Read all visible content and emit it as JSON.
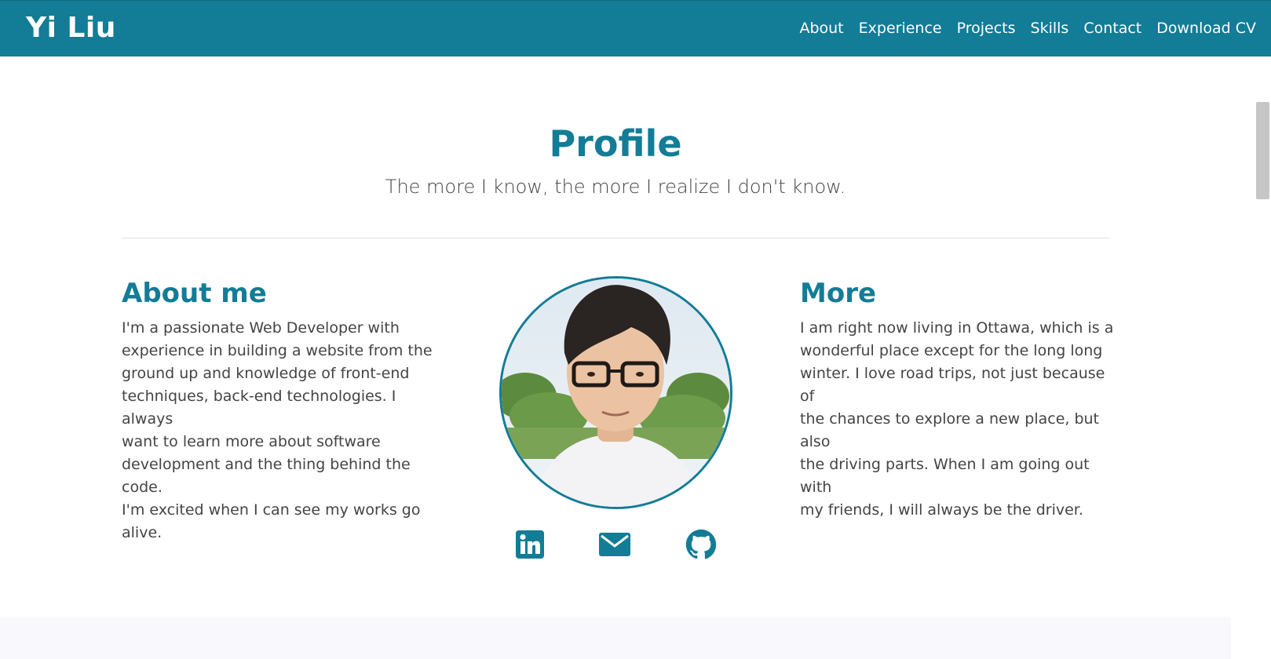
{
  "brand": {
    "name": "Yi Liu"
  },
  "nav": {
    "items": [
      {
        "label": "About"
      },
      {
        "label": "Experience"
      },
      {
        "label": "Projects"
      },
      {
        "label": "Skills"
      },
      {
        "label": "Contact"
      },
      {
        "label": "Download CV"
      }
    ]
  },
  "profile": {
    "title": "Profile",
    "subtitle": "The more I know, the more I realize I don't know."
  },
  "about": {
    "heading": "About me",
    "lines": [
      "I'm a passionate Web Developer with",
      "experience in building a website from the",
      "ground up and knowledge of front-end",
      "techniques, back-end technologies. I always",
      "want to learn more about software",
      "development and the thing behind the code.",
      "I'm excited when I can see my works go alive."
    ]
  },
  "more": {
    "heading": "More",
    "lines": [
      "I am right now living in Ottawa, which is a",
      "wonderful place except for the long long",
      "winter. I love road trips, not just because of",
      "the chances to explore a new place, but also",
      "the driving parts. When I am going out with",
      "my friends, I will always be the driver."
    ]
  },
  "social": {
    "icons": [
      "linkedin-icon",
      "email-icon",
      "github-icon"
    ]
  },
  "colors": {
    "accent": "#137c97",
    "text": "#444444",
    "divider": "#e2e2e2"
  }
}
